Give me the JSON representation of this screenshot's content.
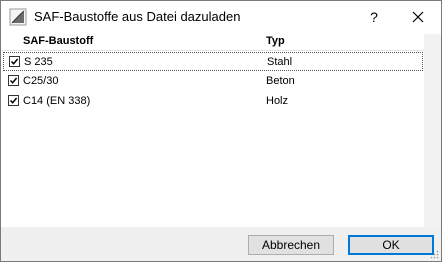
{
  "window": {
    "title": "SAF-Baustoffe aus Datei dazuladen",
    "help_label": "?"
  },
  "table": {
    "columns": [
      "SAF-Baustoff",
      "Typ"
    ],
    "rows": [
      {
        "name": "S 235",
        "type": "Stahl",
        "checked": true
      },
      {
        "name": "C25/30",
        "type": "Beton",
        "checked": true
      },
      {
        "name": "C14 (EN 338)",
        "type": "Holz",
        "checked": true
      }
    ]
  },
  "buttons": {
    "cancel": "Abbrechen",
    "ok": "OK"
  },
  "colors": {
    "accent": "#0078d7"
  }
}
